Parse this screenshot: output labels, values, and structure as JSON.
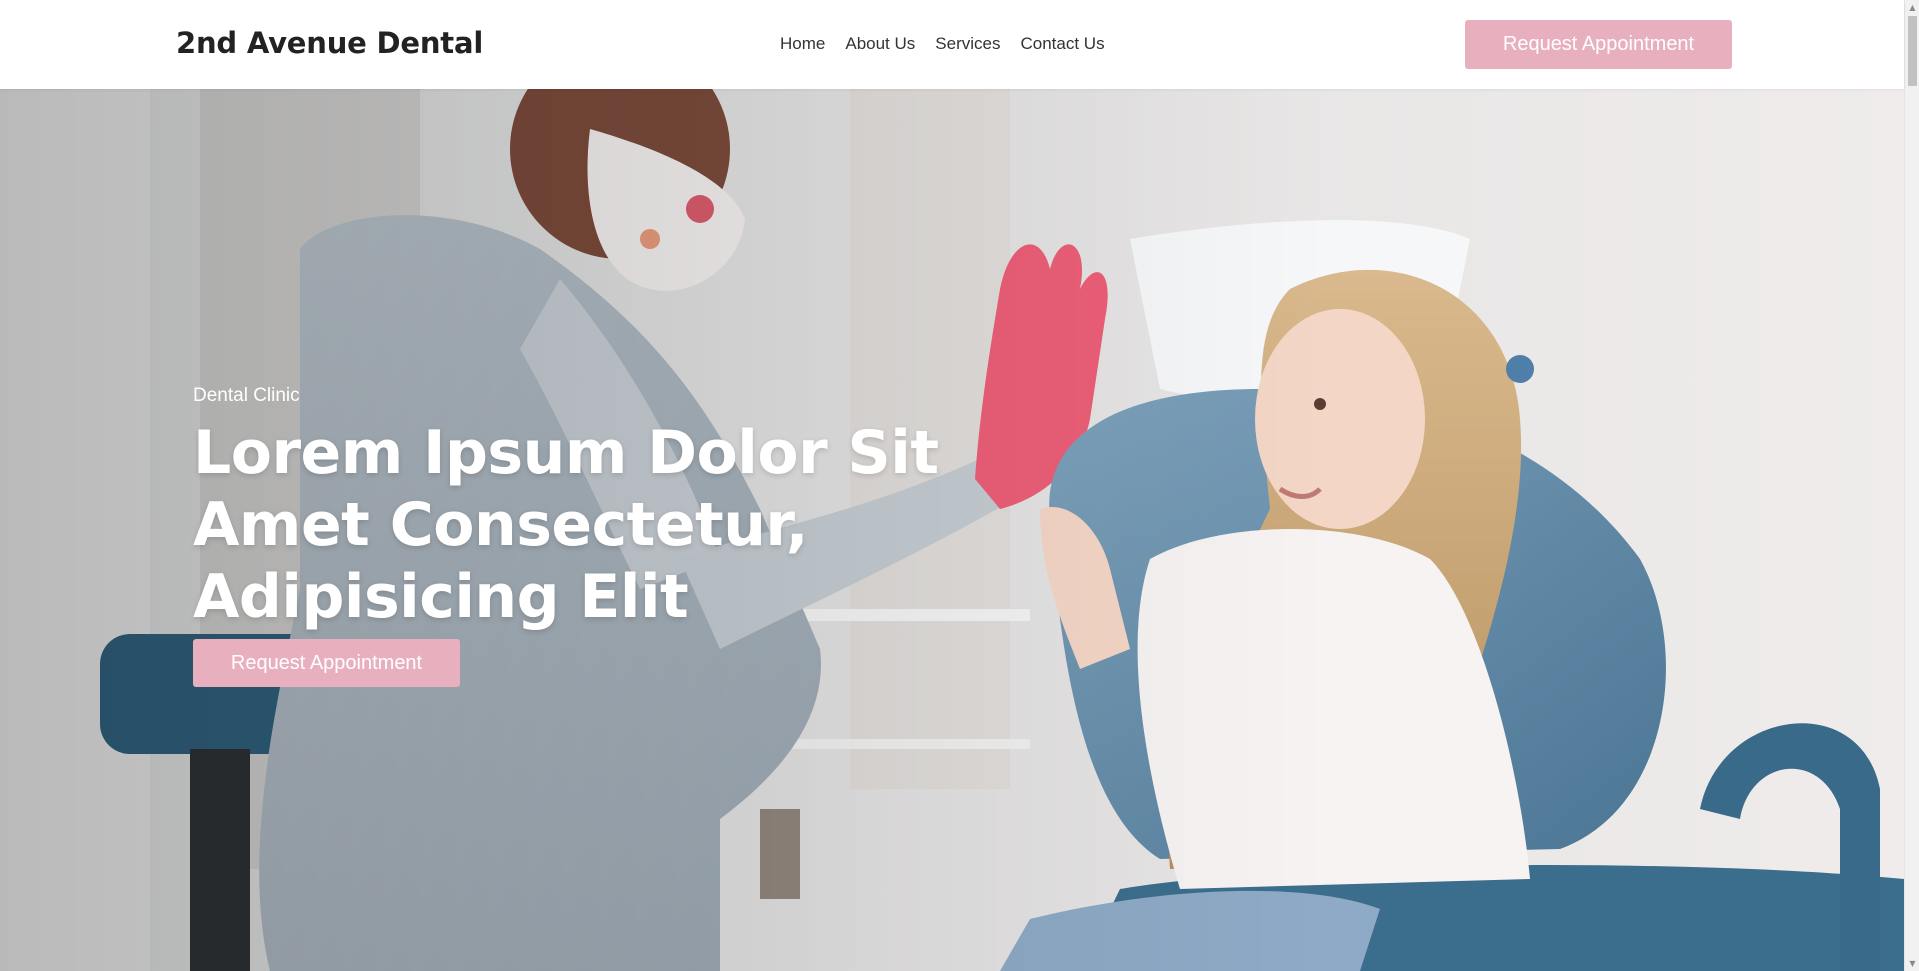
{
  "header": {
    "brand": "2nd Avenue Dental",
    "nav": [
      "Home",
      "About Us",
      "Services",
      "Contact Us"
    ],
    "cta_label": "Request Appointment"
  },
  "hero": {
    "eyebrow": "Dental Clinic",
    "title_lines": [
      "Lorem Ipsum Dolor Sit",
      "Amet Consectetur,",
      "Adipisicing Elit"
    ],
    "cta_label": "Request Appointment",
    "image_subject": "dentist in patterned scrubs giving a high-five to a young girl in a blue dental chair"
  },
  "colors": {
    "accent": "#e8b0bf",
    "header_bg": "#ffffff",
    "hero_text": "#ffffff",
    "brand_text": "#222222"
  },
  "icons": {
    "scroll_up": "scroll-up-arrow-icon",
    "scroll_down": "scroll-down-arrow-icon"
  }
}
